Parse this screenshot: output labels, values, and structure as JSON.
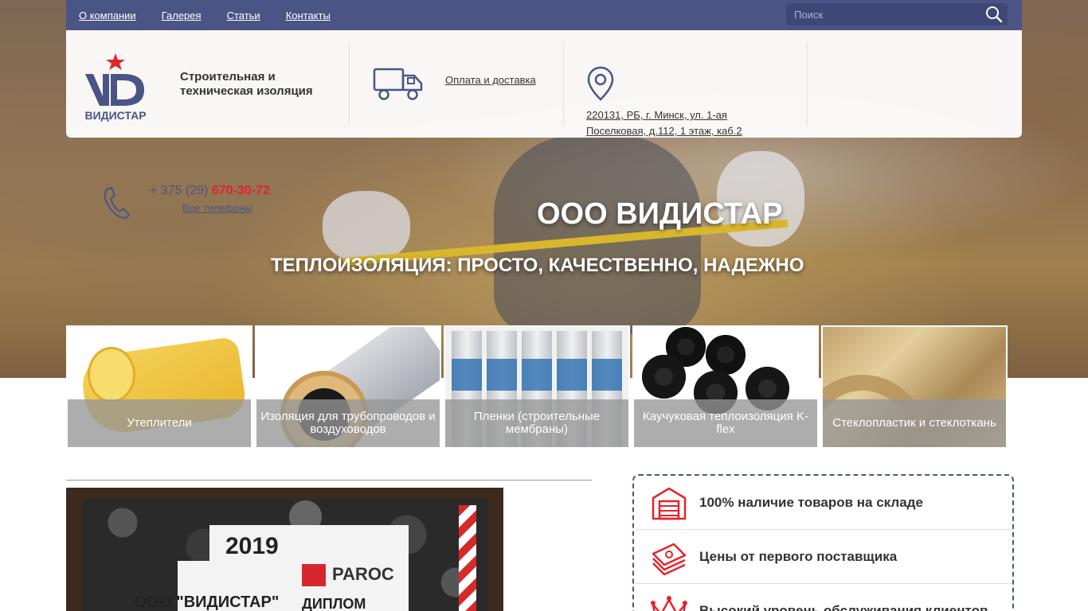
{
  "topnav": {
    "items": [
      "О компании",
      "Галерея",
      "Статьи",
      "Контакты"
    ],
    "search_placeholder": "Поиск"
  },
  "header": {
    "logo_text": "ВИДИСТАР",
    "logo_mark": "VD",
    "tagline": "Строительная и техническая изоляция",
    "delivery_link": "Оплата и доставка",
    "address": "220131, РБ, г. Минск, ул. 1-ая Поселковая, д.112, 1 этаж, каб.2"
  },
  "phone": {
    "prefix": "+ 375 (29) ",
    "number": "670-30-72",
    "all_phones": "Все телефоны"
  },
  "hero": {
    "title": "ООО ВИДИСТАР",
    "subtitle": "ТЕПЛОИЗОЛЯЦИЯ: ПРОСТО, КАЧЕСТВЕННО, НАДЕЖНО"
  },
  "categories": [
    {
      "label": "Утеплители"
    },
    {
      "label": "Изоляция для трубопроводов и воздуховодов"
    },
    {
      "label": "Пленки (строительные мембраны)"
    },
    {
      "label": "Каучуковая теплоизоляция K-flex"
    },
    {
      "label": "Стеклопластик и стеклоткань"
    }
  ],
  "diploma": {
    "year": "2019",
    "brand": "PAROC",
    "company": "ООО \"ВИДИСТАР\"",
    "title": "ДИПЛОМ"
  },
  "features": [
    {
      "text": "100% наличие товаров на складе",
      "icon": "warehouse-icon"
    },
    {
      "text": "Цены от первого поставщика",
      "icon": "money-stack-icon"
    },
    {
      "text": "Высокий уровень обслуживания клиентов",
      "icon": "crown-icon"
    }
  ],
  "colors": {
    "nav_bg": "#4a5585",
    "accent_red": "#e3242b",
    "dashed_border": "#4a5585"
  }
}
